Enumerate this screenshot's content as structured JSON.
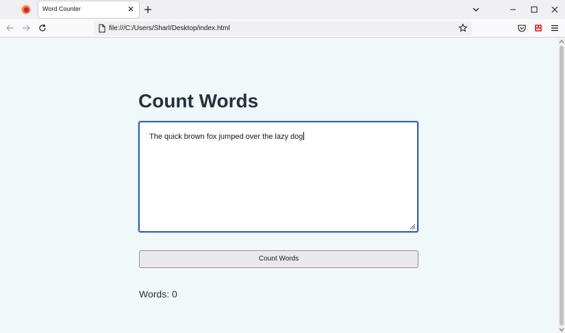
{
  "browser": {
    "tab": {
      "title": "Word Counter"
    },
    "address_bar": {
      "url": "file:///C:/Users/Sharl/Desktop/index.html"
    }
  },
  "page": {
    "heading": "Count Words",
    "text_input": {
      "value": "The quick brown fox jumped over the lazy dog"
    },
    "count_button": {
      "label": "Count Words"
    },
    "result": {
      "text": "Words: 0"
    }
  },
  "colors": {
    "page_background": "#f0f8fa",
    "heading_text": "#25313c",
    "focus_border": "#2f5fa7",
    "button_background": "#e9e9ed"
  }
}
